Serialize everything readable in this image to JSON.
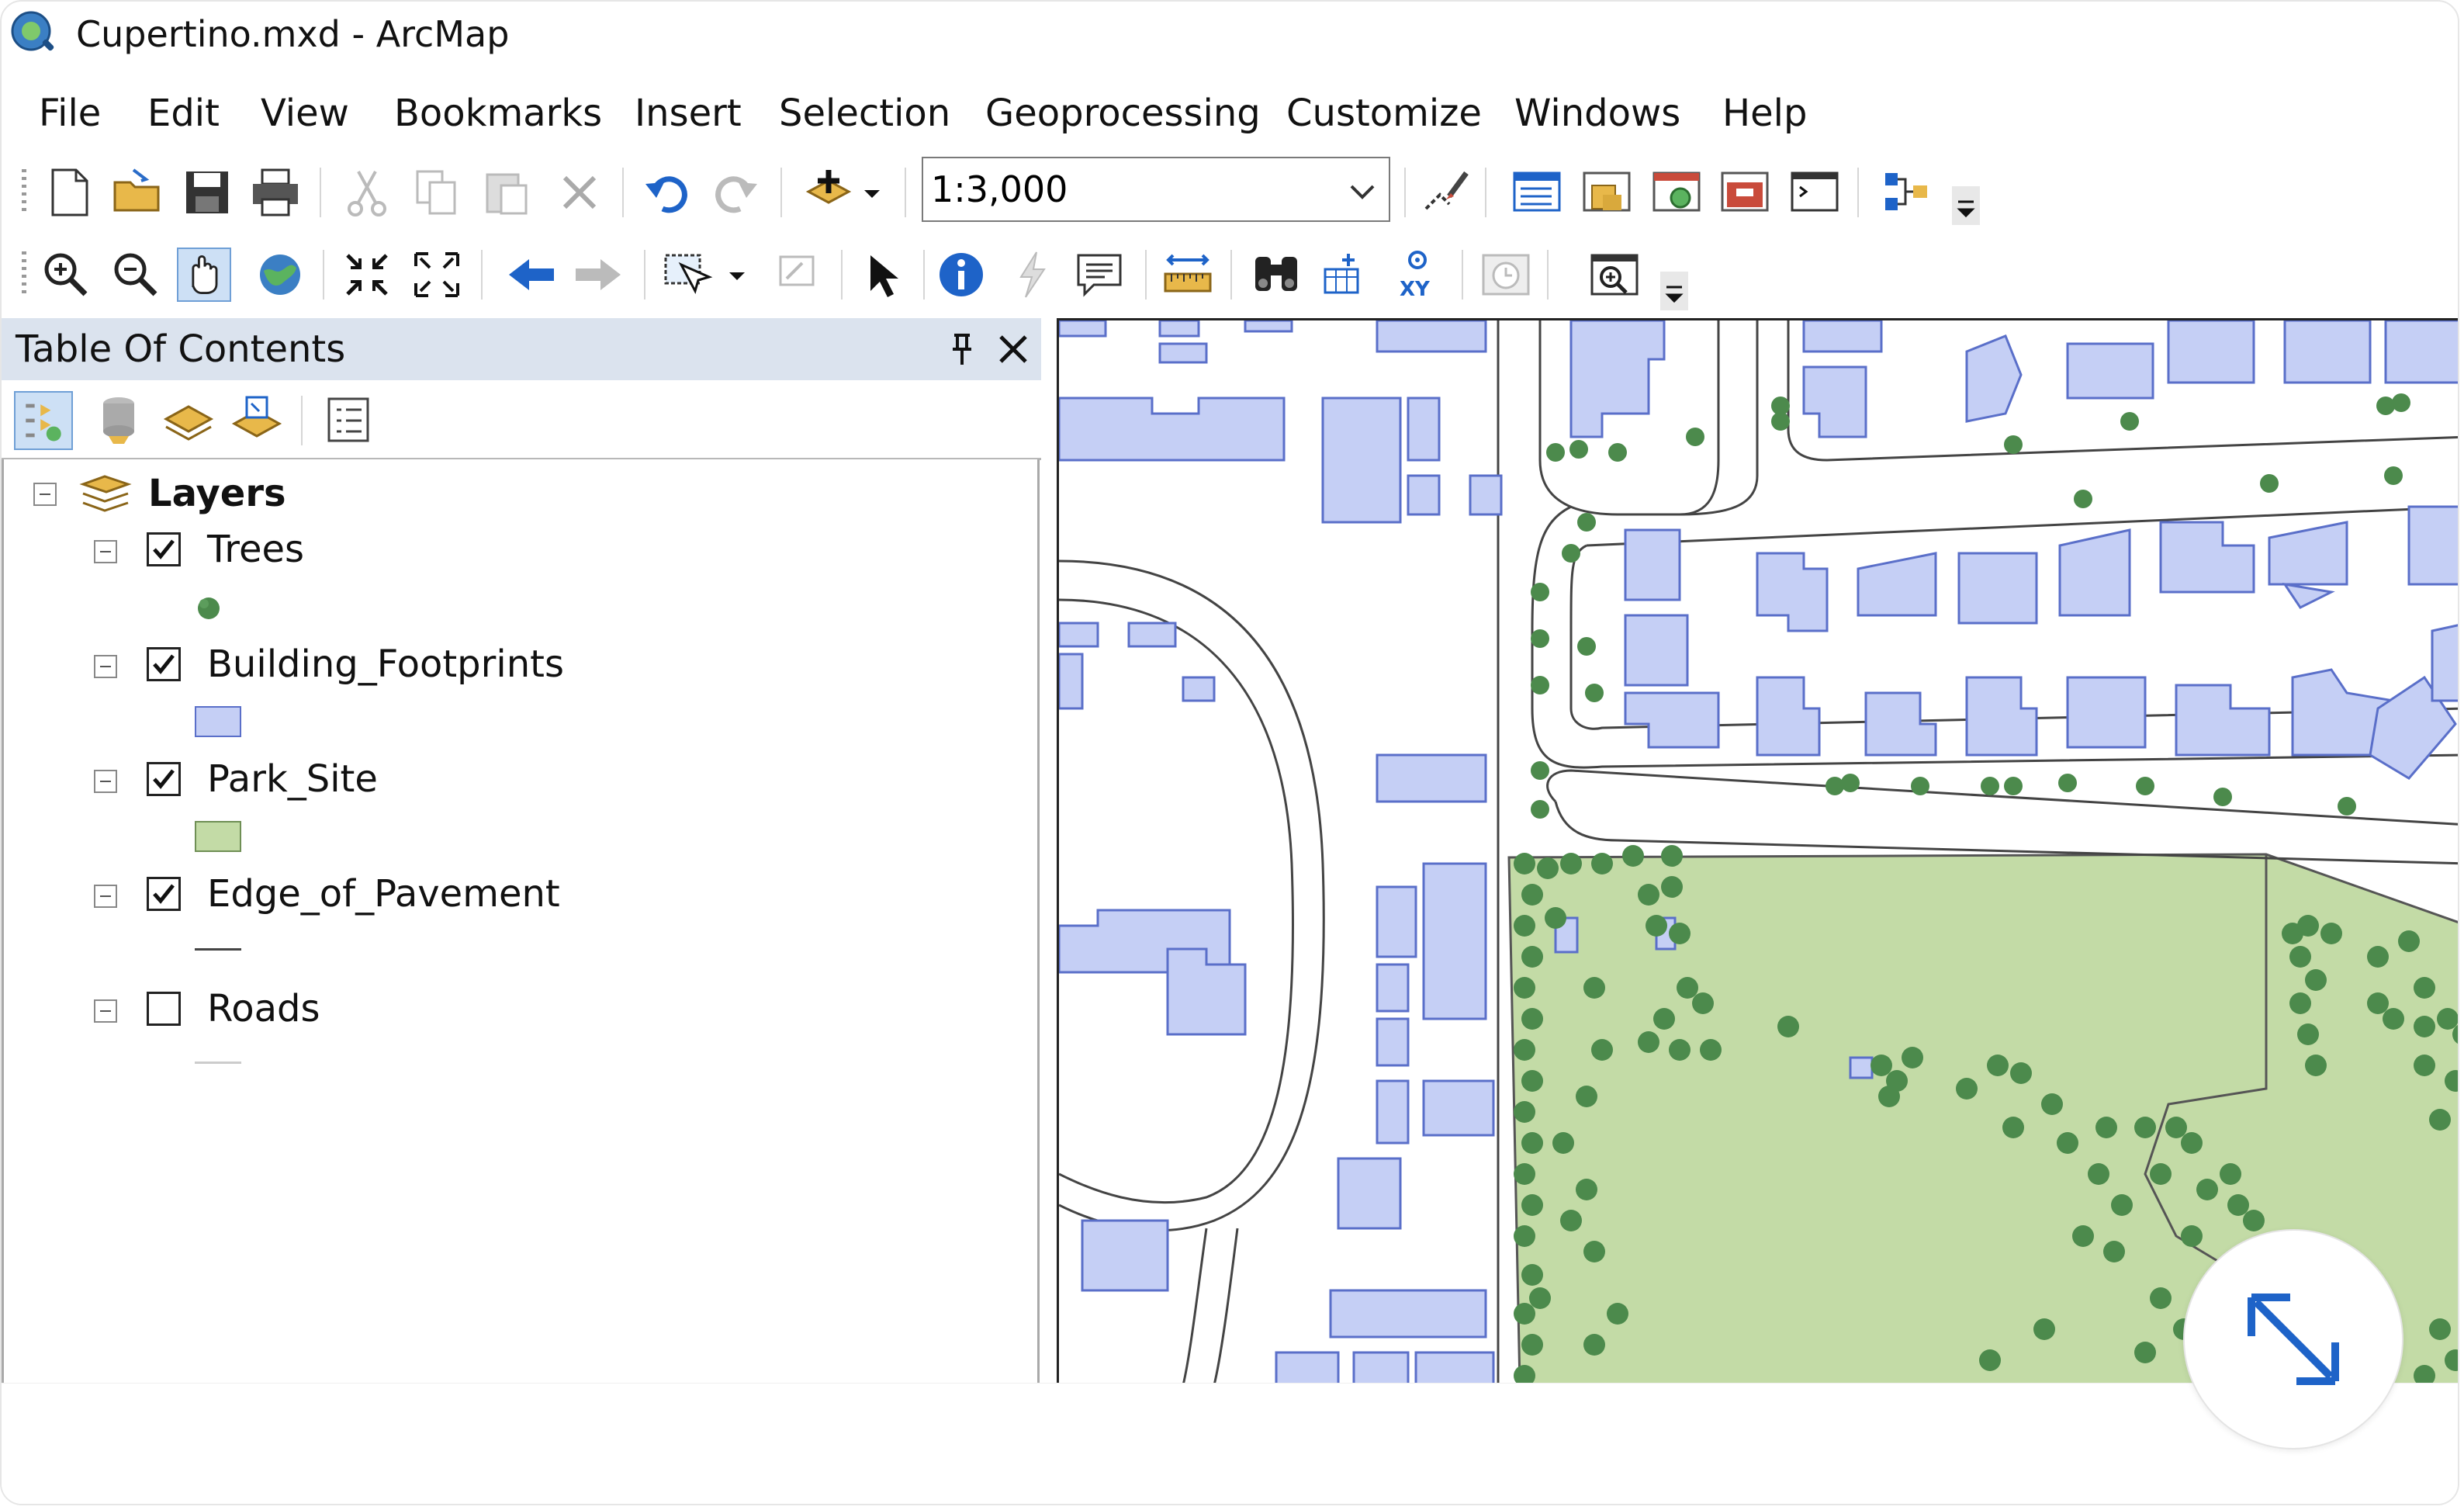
{
  "window": {
    "title": "Cupertino.mxd - ArcMap"
  },
  "menu": {
    "items": [
      "File",
      "Edit",
      "View",
      "Bookmarks",
      "Insert",
      "Selection",
      "Geoprocessing",
      "Customize",
      "Windows",
      "Help"
    ]
  },
  "toolbar_standard": {
    "scale_value": "1:3,000",
    "icons": [
      "new-document-icon",
      "open-folder-icon",
      "save-icon",
      "print-icon",
      "cut-icon",
      "copy-icon",
      "paste-icon",
      "delete-icon",
      "undo-icon",
      "redo-icon",
      "add-data-icon",
      "editor-toolbar-icon",
      "table-of-contents-icon",
      "catalog-window-icon",
      "search-window-icon",
      "arctoolbox-icon",
      "python-window-icon",
      "model-builder-icon",
      "toolbar-options-icon"
    ]
  },
  "toolbar_tools": {
    "icons": [
      "zoom-in-icon",
      "zoom-out-icon",
      "pan-hand-icon",
      "full-extent-icon",
      "fixed-zoom-in-icon",
      "fixed-zoom-out-icon",
      "back-arrow-icon",
      "forward-arrow-icon",
      "select-features-icon",
      "clear-selection-icon",
      "select-elements-icon",
      "identify-icon",
      "hyperlink-icon",
      "html-popup-icon",
      "measure-icon",
      "find-icon",
      "find-route-icon",
      "go-to-xy-icon",
      "time-slider-icon",
      "create-viewer-window-icon",
      "toolbar-options-icon"
    ]
  },
  "toc": {
    "title": "Table Of Contents",
    "root_label": "Layers",
    "layers": [
      {
        "name": "Trees",
        "checked": true,
        "symbol": "point",
        "color": "#4c8a4c"
      },
      {
        "name": "Building_Footprints",
        "checked": true,
        "symbol": "polygon",
        "color": "#c5cff5"
      },
      {
        "name": "Park_Site",
        "checked": true,
        "symbol": "polygon",
        "color": "#c3dba6"
      },
      {
        "name": "Edge_of_Pavement",
        "checked": true,
        "symbol": "line",
        "color": "#444444"
      },
      {
        "name": "Roads",
        "checked": false,
        "symbol": "line",
        "color": "#cccccc"
      }
    ]
  },
  "colors": {
    "building_fill": "#c5cff5",
    "building_stroke": "#5a6fc9",
    "park_fill": "#c3dba6",
    "tree_fill": "#4c8a4c",
    "toc_header_bg": "#dbe3ee",
    "accent_blue": "#1e63c8"
  }
}
